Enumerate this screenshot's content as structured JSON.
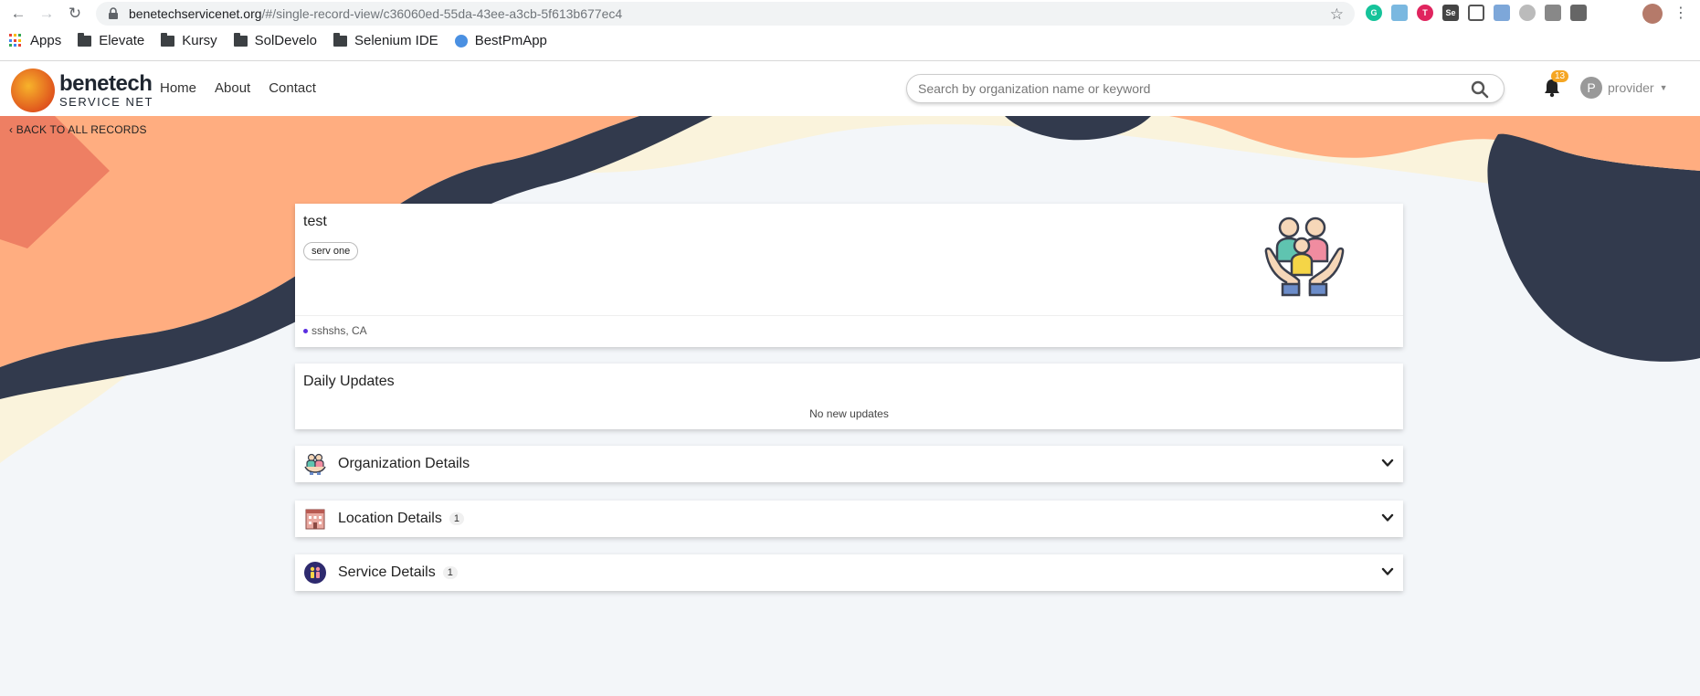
{
  "browser": {
    "url_host": "benetechservicenet.org",
    "url_path": "/#/single-record-view/c36060ed-55da-43ee-a3cb-5f613b677ec4",
    "bookmarks": [
      {
        "label": "Apps",
        "icon": "apps-icon"
      },
      {
        "label": "Elevate",
        "icon": "folder-icon"
      },
      {
        "label": "Kursy",
        "icon": "folder-icon"
      },
      {
        "label": "SolDevelo",
        "icon": "folder-icon"
      },
      {
        "label": "Selenium IDE",
        "icon": "folder-icon"
      },
      {
        "label": "BestPmApp",
        "icon": "bestpmapp-icon"
      }
    ]
  },
  "header": {
    "logo_main": "benetech",
    "logo_sub": "SERVICE NET",
    "nav": [
      "Home",
      "About",
      "Contact"
    ],
    "search_placeholder": "Search by organization name or keyword",
    "notification_count": "13",
    "user_initial": "P",
    "user_name": "provider"
  },
  "back_link": "BACK TO ALL RECORDS",
  "record": {
    "title": "test",
    "tag": "serv one",
    "address": "sshshs, CA"
  },
  "updates": {
    "title": "Daily Updates",
    "empty_text": "No new updates"
  },
  "sections": {
    "organization": {
      "title": "Organization Details"
    },
    "location": {
      "title": "Location Details",
      "count": "1"
    },
    "service": {
      "title": "Service Details",
      "count": "1"
    }
  },
  "colors": {
    "accent_orange": "#ffad80",
    "navy": "#323a4d",
    "cream": "#faf3dc",
    "page_bg": "#f3f6f9"
  }
}
